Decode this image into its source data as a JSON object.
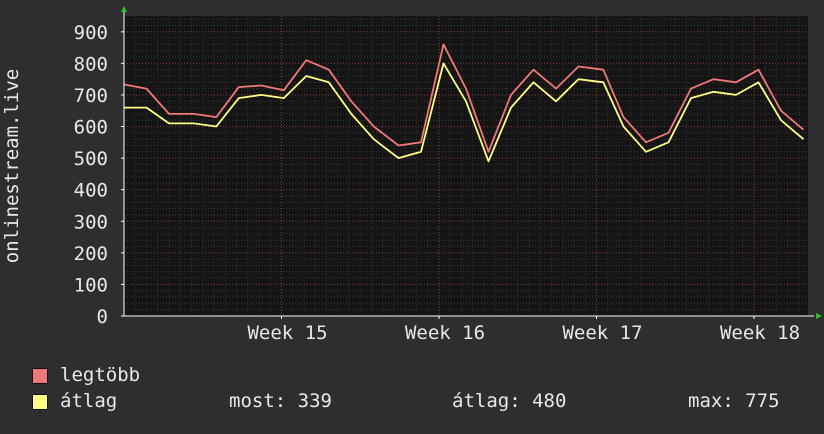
{
  "chart_data": {
    "type": "line",
    "ylabel": "onlinestream.live",
    "ylim": [
      0,
      950
    ],
    "y_ticks": [
      0,
      100,
      200,
      300,
      400,
      500,
      600,
      700,
      800,
      900
    ],
    "x_ticks": [
      {
        "label": "Week 15",
        "day": 7
      },
      {
        "label": "Week 16",
        "day": 14
      },
      {
        "label": "Week 17",
        "day": 21
      },
      {
        "label": "Week 18",
        "day": 28
      }
    ],
    "xlim_days": [
      0,
      30.4
    ],
    "grid": true,
    "series": [
      {
        "name": "legtöbb",
        "color": "#f07878",
        "values": [
          [
            0.0,
            733
          ],
          [
            1.0,
            720
          ],
          [
            2.0,
            640
          ],
          [
            3.1,
            640
          ],
          [
            4.1,
            630
          ],
          [
            5.1,
            725
          ],
          [
            6.1,
            730
          ],
          [
            7.1,
            715
          ],
          [
            8.1,
            810
          ],
          [
            9.1,
            780
          ],
          [
            10.1,
            680
          ],
          [
            11.1,
            600
          ],
          [
            12.2,
            540
          ],
          [
            13.2,
            550
          ],
          [
            14.2,
            860
          ],
          [
            15.2,
            720
          ],
          [
            16.2,
            520
          ],
          [
            17.2,
            700
          ],
          [
            18.2,
            780
          ],
          [
            19.2,
            720
          ],
          [
            20.2,
            790
          ],
          [
            21.3,
            780
          ],
          [
            22.2,
            630
          ],
          [
            23.2,
            550
          ],
          [
            24.2,
            580
          ],
          [
            25.2,
            720
          ],
          [
            26.2,
            750
          ],
          [
            27.2,
            740
          ],
          [
            28.2,
            780
          ],
          [
            29.2,
            650
          ],
          [
            30.2,
            590
          ]
        ]
      },
      {
        "name": "átlag",
        "color": "#ffff80",
        "values": [
          [
            0.0,
            660
          ],
          [
            1.0,
            660
          ],
          [
            2.0,
            610
          ],
          [
            3.1,
            610
          ],
          [
            4.1,
            600
          ],
          [
            5.1,
            690
          ],
          [
            6.1,
            700
          ],
          [
            7.1,
            690
          ],
          [
            8.1,
            760
          ],
          [
            9.1,
            740
          ],
          [
            10.1,
            640
          ],
          [
            11.1,
            560
          ],
          [
            12.2,
            500
          ],
          [
            13.2,
            520
          ],
          [
            14.2,
            800
          ],
          [
            15.2,
            680
          ],
          [
            16.2,
            490
          ],
          [
            17.2,
            660
          ],
          [
            18.2,
            740
          ],
          [
            19.2,
            680
          ],
          [
            20.2,
            750
          ],
          [
            21.3,
            740
          ],
          [
            22.2,
            600
          ],
          [
            23.2,
            520
          ],
          [
            24.2,
            550
          ],
          [
            25.2,
            690
          ],
          [
            26.2,
            710
          ],
          [
            27.2,
            700
          ],
          [
            28.2,
            740
          ],
          [
            29.2,
            620
          ],
          [
            30.2,
            560
          ]
        ]
      }
    ],
    "legend": [
      {
        "label": "legtöbb",
        "color": "#f07878"
      },
      {
        "label": "átlag",
        "color": "#ffff80"
      }
    ],
    "stats": [
      {
        "label": "most: 339"
      },
      {
        "label": "átlag: 480"
      },
      {
        "label": "max: 775"
      }
    ]
  }
}
